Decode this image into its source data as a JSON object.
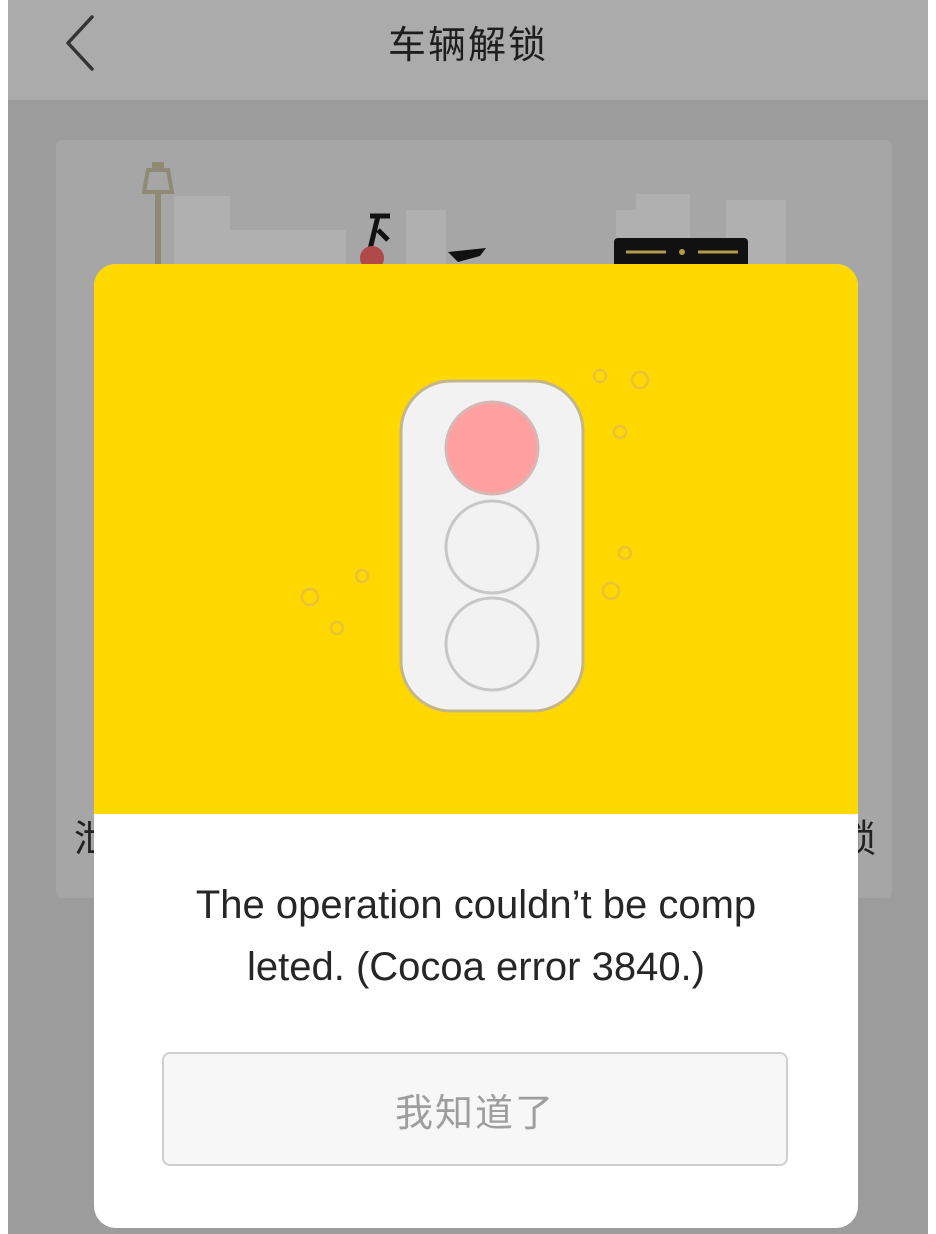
{
  "header": {
    "back_icon": "chevron-left-icon",
    "title": "车辆解锁"
  },
  "background_card": {
    "text_left_fragment": "泄",
    "text_right_fragment": "锁"
  },
  "dialog": {
    "illustration_icon": "traffic-light-icon",
    "message_line1": "The operation couldn’t be comp",
    "message_line2": "leted. (Cocoa error 3840.)",
    "confirm_label": "我知道了"
  },
  "colors": {
    "banner": "#ffd800",
    "red_light": "#ff9f9f",
    "overlay": "#9c9c9c"
  }
}
